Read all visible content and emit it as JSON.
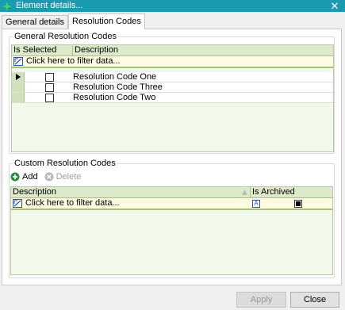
{
  "window": {
    "title": "Element details...",
    "close_glyph": "✕"
  },
  "tabs": [
    {
      "label": "General details",
      "active": false
    },
    {
      "label": "Resolution Codes",
      "active": true
    }
  ],
  "general_codes": {
    "legend": "General Resolution Codes",
    "columns": [
      "Is Selected",
      "Description"
    ],
    "filter_text": "Click here to filter data...",
    "rows": [
      {
        "description": "Resolution Code One",
        "selected": false,
        "current": true
      },
      {
        "description": "Resolution Code Three",
        "selected": false,
        "current": false
      },
      {
        "description": "Resolution Code Two",
        "selected": false,
        "current": false
      }
    ]
  },
  "custom_codes": {
    "legend": "Custom Resolution Codes",
    "add_label": "Add",
    "delete_label": "Delete",
    "columns": [
      "Description",
      "Is Archived"
    ],
    "filter_text": "Click here to filter data...",
    "filter_operator_glyph": "A",
    "rows": []
  },
  "buttons": {
    "apply": "Apply",
    "close": "Close"
  },
  "colors": {
    "titlebar": "#1b9bb0",
    "grid_header": "#dde9cb",
    "filter_row": "#fffbe1"
  }
}
